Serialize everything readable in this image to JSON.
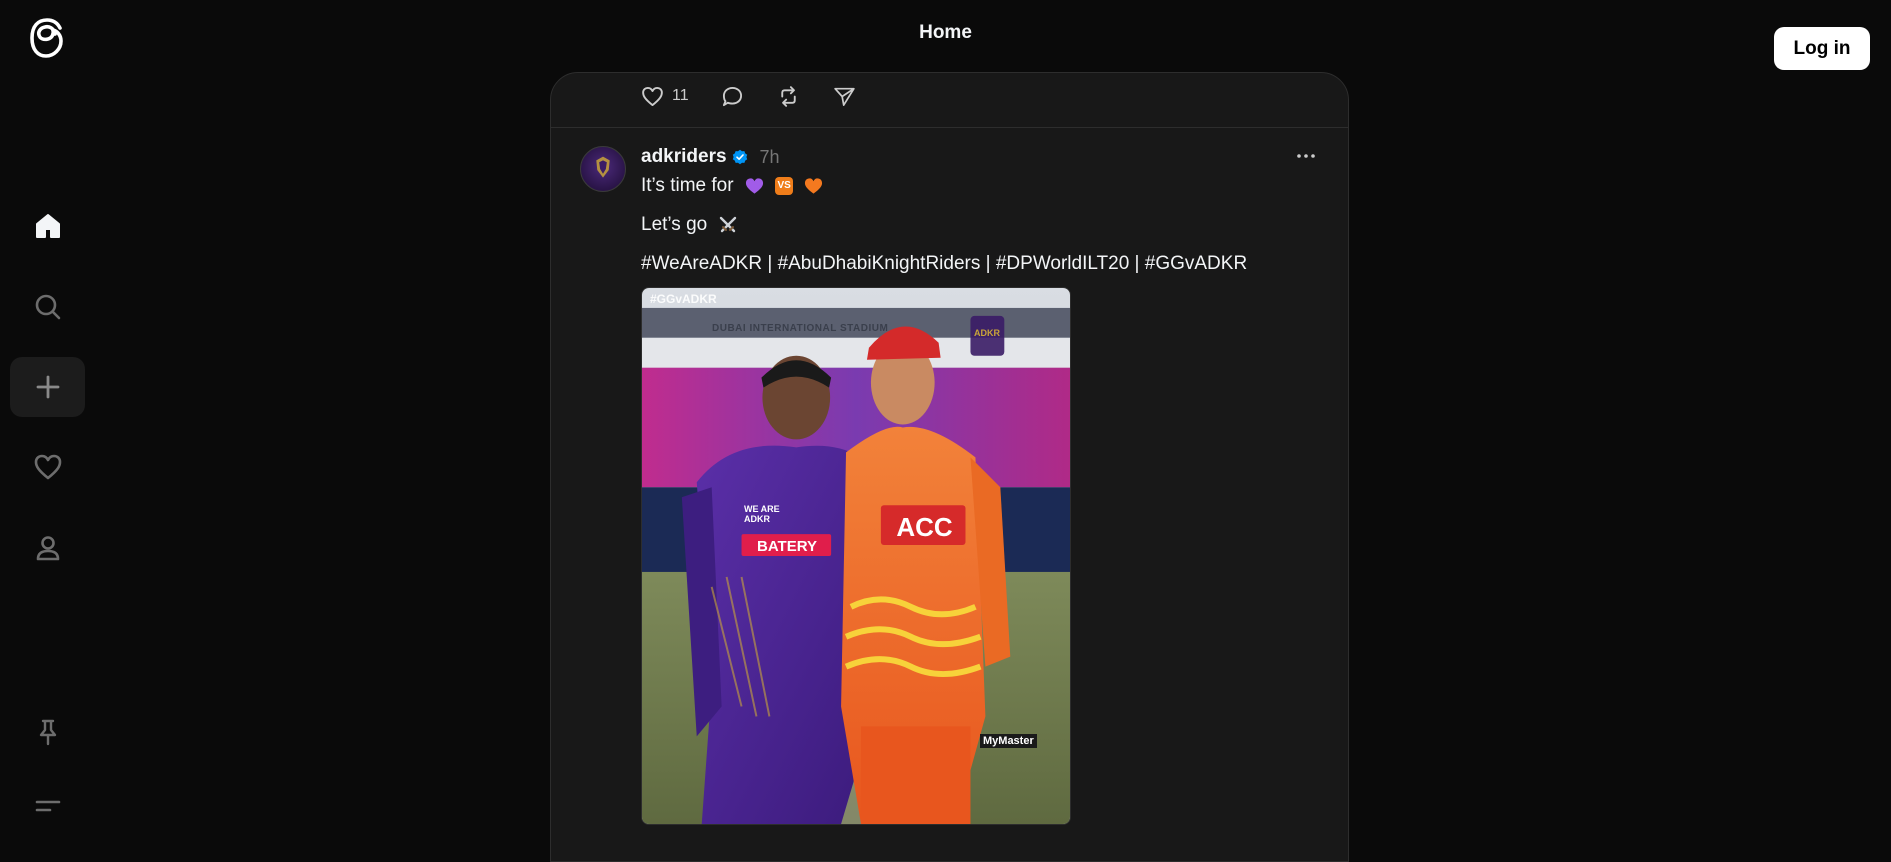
{
  "header": {
    "title": "Home",
    "login_label": "Log in"
  },
  "sidebar": {
    "items": [
      {
        "name": "home",
        "icon": "home-icon"
      },
      {
        "name": "search",
        "icon": "search-icon"
      },
      {
        "name": "create",
        "icon": "plus-icon"
      },
      {
        "name": "activity",
        "icon": "heart-icon"
      },
      {
        "name": "profile",
        "icon": "user-icon"
      },
      {
        "name": "pinned",
        "icon": "pin-icon"
      },
      {
        "name": "menu",
        "icon": "menu-icon"
      }
    ]
  },
  "previous_post": {
    "like_count": "11"
  },
  "post": {
    "username": "adkriders",
    "time": "7h",
    "line1": "It’s time for",
    "line2": "Let’s go",
    "hashtags": "#WeAreADKR | #AbuDhabiKnightRiders | #DPWorldILT20 | #GGvADKR",
    "vs_label": "VS",
    "image_tag": "#GGvADKR",
    "image_text": {
      "stadium": "DUBAI INTERNATIONAL STADIUM",
      "left_jersey_team": "WE ARE ADKR",
      "left_jersey_sponsor": "BATERY",
      "right_jersey_sponsor": "ACC",
      "right_jersey_brand": "MyMaster",
      "badge": "ADKR"
    }
  },
  "colors": {
    "background": "#0a0a0a",
    "card": "#181818",
    "verified": "#0095f6",
    "purple_heart": "#a15ce8",
    "orange_heart": "#f4791f"
  }
}
